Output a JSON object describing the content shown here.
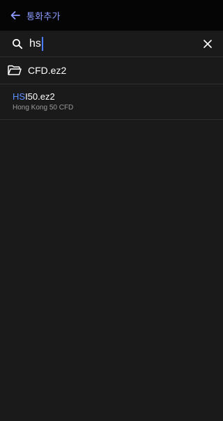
{
  "appbar": {
    "back_icon": "arrow-left-icon",
    "title": "통화추가",
    "accent_color": "#8c9bff"
  },
  "search": {
    "icon": "search-icon",
    "value": "hs",
    "clear_icon": "close-icon"
  },
  "folder": {
    "icon": "folder-open-icon",
    "name": "CFD.ez2"
  },
  "results": [
    {
      "symbol_match": "HS",
      "symbol_rest": "I50.ez2",
      "description": "Hong Kong 50 CFD",
      "highlight_color": "#5a8dff"
    }
  ]
}
